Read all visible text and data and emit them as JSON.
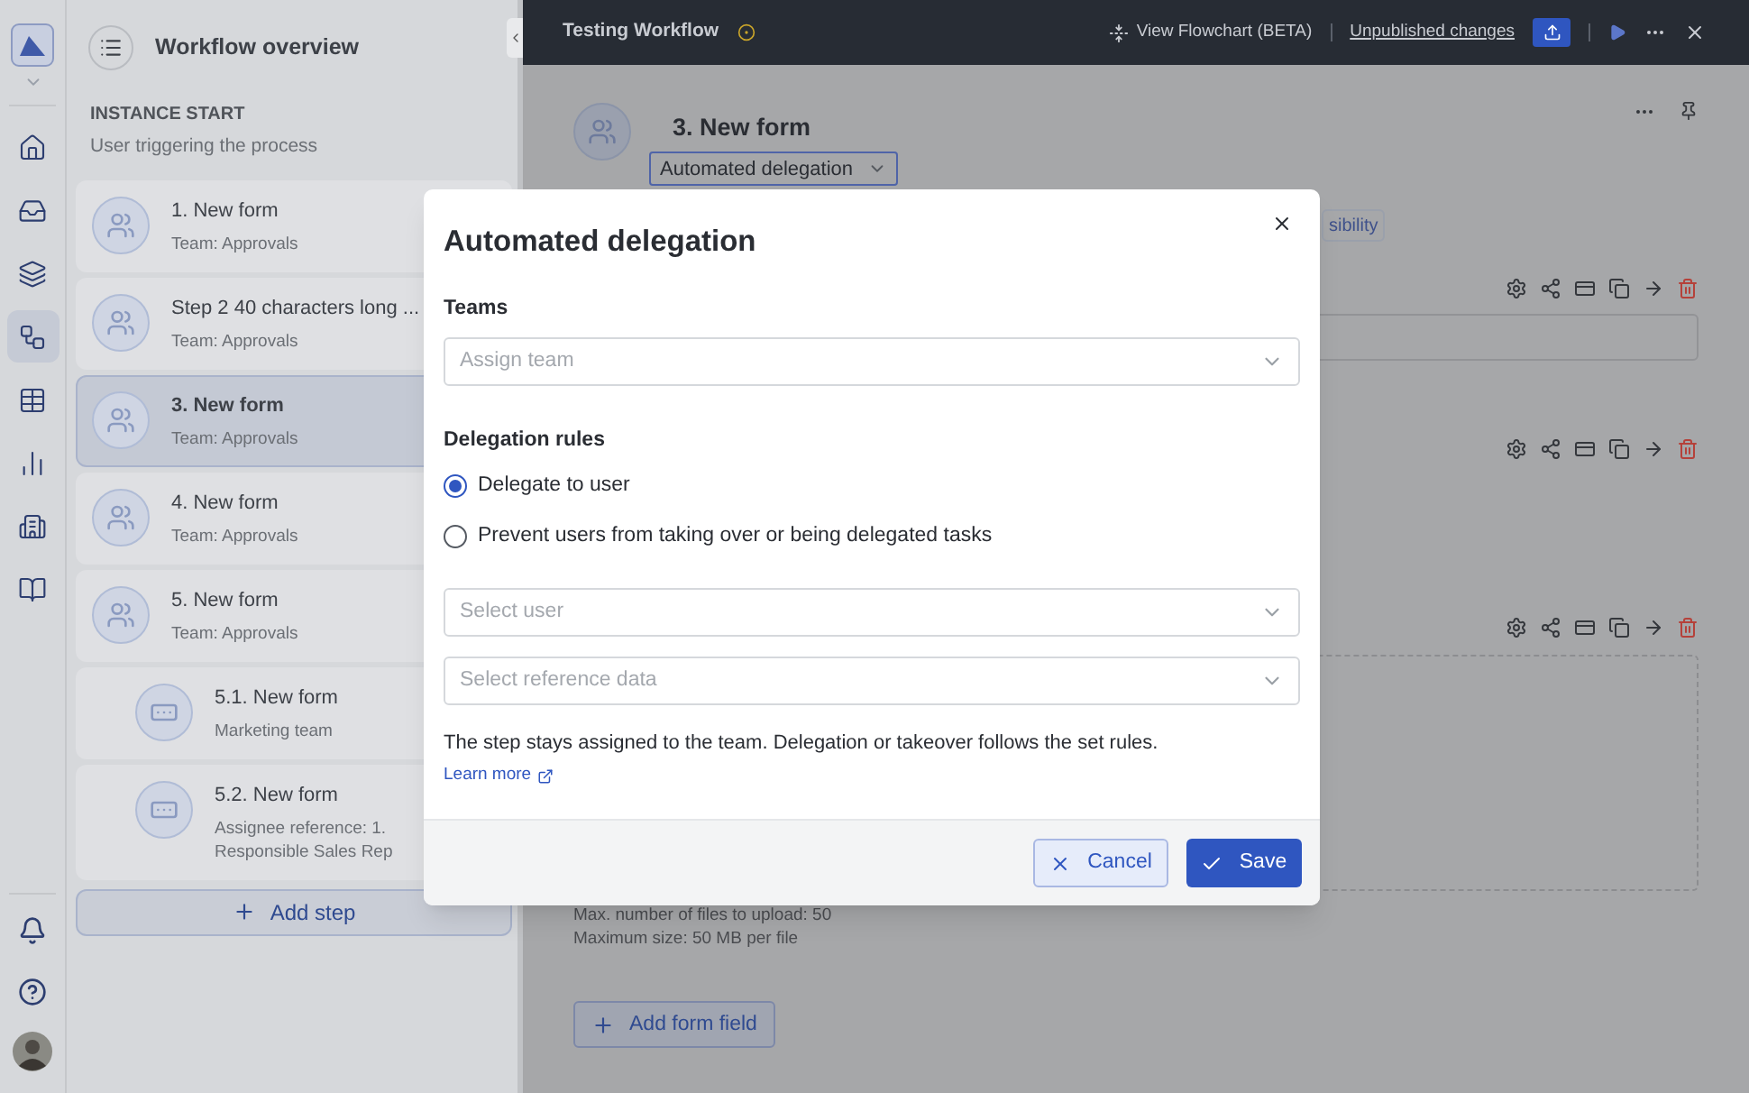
{
  "rail": {
    "items": [
      {
        "selected": false
      },
      {
        "selected": false
      },
      {
        "selected": false
      },
      {
        "selected": true
      },
      {
        "selected": false
      },
      {
        "selected": false
      },
      {
        "selected": false
      },
      {
        "selected": false
      }
    ]
  },
  "sidebar": {
    "title": "Workflow overview",
    "start_heading": "INSTANCE START",
    "start_subtitle": "User triggering the process",
    "steps": [
      {
        "title": "1. New form",
        "subtitle": "Team: Approvals",
        "selected": false
      },
      {
        "title": "Step 2 40 characters long ...",
        "subtitle": "Team: Approvals",
        "selected": false
      },
      {
        "title": "3. New form",
        "subtitle": "Team: Approvals",
        "selected": true
      },
      {
        "title": "4. New form",
        "subtitle": "Team: Approvals",
        "selected": false
      },
      {
        "title": "5. New form",
        "subtitle": "Team: Approvals",
        "selected": false,
        "children": [
          {
            "title": "5.1. New form",
            "subtitle": "Marketing team",
            "selected": false
          },
          {
            "title": "5.2. New form",
            "subtitle": "Assignee reference: 1. Responsible Sales Rep",
            "selected": false
          }
        ]
      }
    ],
    "add_step": "Add step"
  },
  "top_bar": {
    "title": "Testing Workflow",
    "view_flowchart": "View Flowchart (BETA)",
    "unpublished": "Unpublished changes"
  },
  "step": {
    "title": "3. New form",
    "assignment": "Automated delegation",
    "tag": "sibility",
    "fields": [
      {
        "kind": "input"
      },
      {
        "kind": "blank"
      },
      {
        "kind": "upload",
        "notes": [
          "Max. number of files to upload: 50",
          "Maximum size: 50 MB per file"
        ]
      }
    ],
    "add_field": "Add form field"
  },
  "dialog": {
    "title": "Automated delegation",
    "teams_label": "Teams",
    "team_placeholder": "Assign team",
    "rules_label": "Delegation rules",
    "rules": [
      {
        "label": "Delegate to user",
        "selected": true
      },
      {
        "label": "Prevent users from taking over or being delegated tasks",
        "selected": false
      }
    ],
    "user_placeholder": "Select user",
    "reference_placeholder": "Select reference data",
    "note": "The step stays assigned to the team. Delegation or takeover follows the set rules.",
    "learn_more": "Learn more",
    "cancel": "Cancel",
    "save": "Save"
  }
}
